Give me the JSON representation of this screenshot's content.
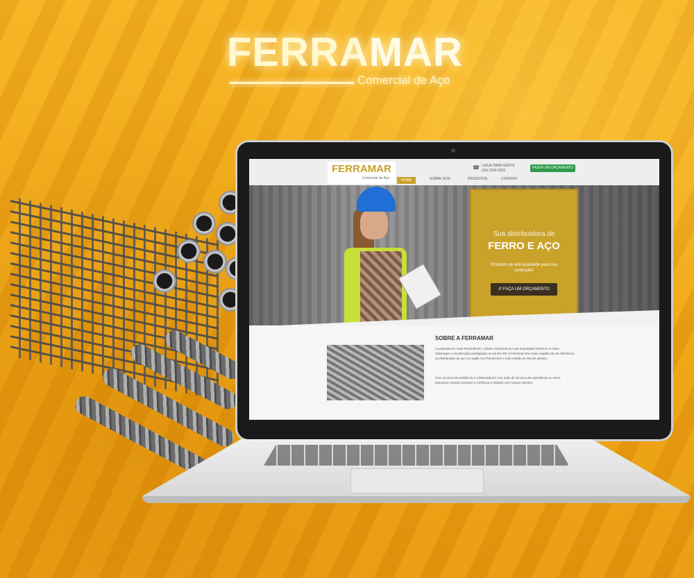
{
  "brand": {
    "name_part1": "FERRA",
    "name_part2": "MAR",
    "tagline": "Comercial de Aço"
  },
  "website": {
    "logo_text": "FERRAMAR",
    "logo_sub": "Comercial de Aço",
    "phone_label": "LIGUE PARA GENTE",
    "phone_number": "(24) 3343-2910",
    "quote_button": "FAZER UM ORÇAMENTO",
    "nav": [
      {
        "label": "HOME",
        "active": true
      },
      {
        "label": "SOBRE NOS"
      },
      {
        "label": "PRODUTOS"
      },
      {
        "label": "CONTATO"
      }
    ],
    "hero": {
      "line1": "Sua distribuidora de",
      "line2": "FERRO E AÇO",
      "line3": "Produtos de alta qualidade para sua contrução!",
      "button": "FAÇA UM ORÇAMENTO"
    },
    "about": {
      "title": "SOBRE A FERRAMAR",
      "p1": "Localizada em Volta Redonda-RJ, cidade conhecida por sua importante histórica no ramo Siderúrgico e localização privilegiada na rua Rio-SP, a Ferramar tem muito orgulho de ser referência na distribuição de aço na região Sul Fluminense e todo estado do Rio de Janeiro.",
      "p2": "Com 18 anos de existência e colaboradores com mais de 40 anos de experiência no ramo, buscamos sempre priorizar a confiança e relação com nossos clientes."
    }
  },
  "colors": {
    "background": "#f2a91a",
    "brand_gold": "#c9a22a",
    "button_green": "#2f9b4a"
  }
}
